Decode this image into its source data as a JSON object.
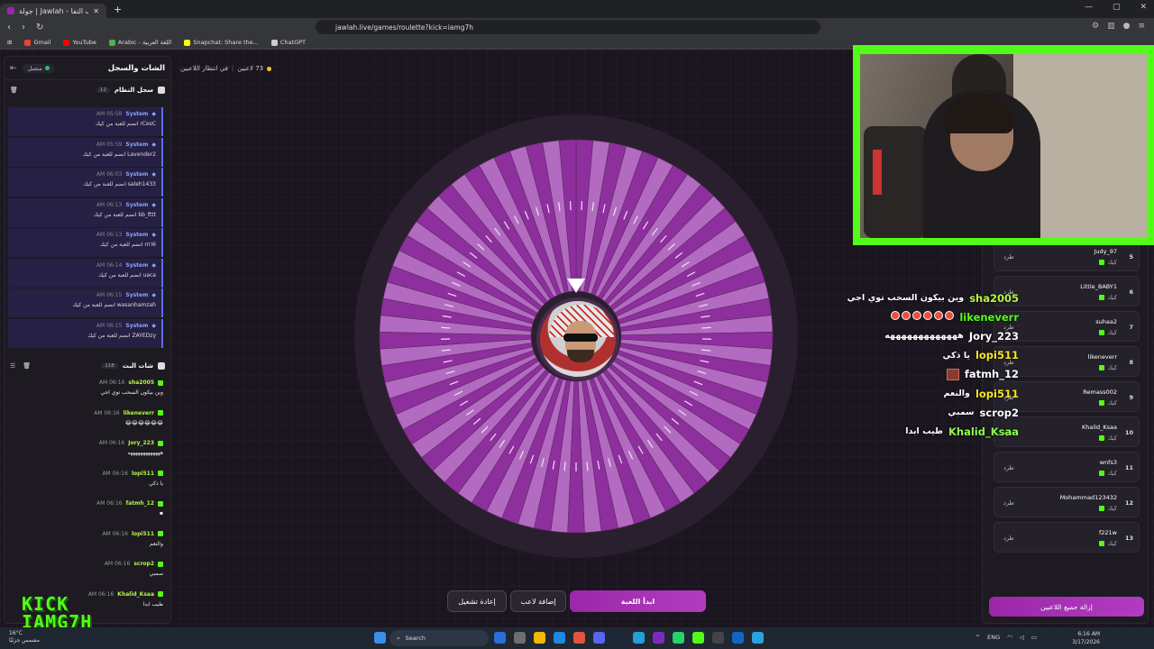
{
  "browser": {
    "tab_title": "جولة | Jawlah - منصة الألعاب التفا...",
    "url": "jawlah.live/games/roulette?kick=iamg7h",
    "bookmarks": [
      {
        "label": "Gmail",
        "color": "#ea4335"
      },
      {
        "label": "YouTube",
        "color": "#ff0000"
      },
      {
        "label": "Arabic - اللغة العربية",
        "color": "#4caf50"
      },
      {
        "label": "Snapchat: Share the...",
        "color": "#fffc00"
      },
      {
        "label": "ChatGPT",
        "color": "#cccccc"
      }
    ]
  },
  "chat_panel": {
    "title": "الشات والسجل",
    "connection_pill": "متصل",
    "system_log_title": "سجل النظام",
    "system_log_count": "12",
    "system_messages": [
      {
        "who": "System",
        "time": "AM 05:58",
        "body": "rCesC انضم للعبة من كيك"
      },
      {
        "who": "System",
        "time": "AM 05:59",
        "body": "Lavender2 انضم للعبة من كيك"
      },
      {
        "who": "System",
        "time": "AM 06:03",
        "body": "saleh1433 انضم للعبة من كيك"
      },
      {
        "who": "System",
        "time": "AM 06:13",
        "body": "bb_fttt انضم للعبة من كيك"
      },
      {
        "who": "System",
        "time": "AM 06:13",
        "body": "rrri6 انضم للعبة من كيك"
      },
      {
        "who": "System",
        "time": "AM 06:14",
        "body": "uaca انضم للعبة من كيك"
      },
      {
        "who": "System",
        "time": "AM 06:15",
        "body": "wasanhamzah انضم للعبة من كيك"
      },
      {
        "who": "System",
        "time": "AM 06:15",
        "body": "ZAYEDzy انضم للعبة من كيك"
      }
    ],
    "live_chat_title": "شات البث",
    "live_chat_count": "118",
    "live_messages": [
      {
        "who": "sha2005",
        "time": "AM 06:16",
        "body": "وين بيكون السحب توي اجي"
      },
      {
        "who": "likeneverr",
        "time": "AM 06:16",
        "body": "😂😂😂😂😂😂"
      },
      {
        "who": "Jory_223",
        "time": "AM 06:16",
        "body": "هههههههههههههه"
      },
      {
        "who": "lopi511",
        "time": "AM 06:16",
        "body": "يا ذكي"
      },
      {
        "who": "fatmh_12",
        "time": "AM 06:16",
        "body": "▪"
      },
      {
        "who": "lopi511",
        "time": "AM 06:16",
        "body": "والنعم"
      },
      {
        "who": "scrop2",
        "time": "AM 06:16",
        "body": "سمبي"
      },
      {
        "who": "Khalid_Ksaa",
        "time": "AM 06:16",
        "body": "طيب ابدا"
      }
    ]
  },
  "status": {
    "players_text": "73 لاعبين",
    "waiting_text": "في انتظار اللاعبين"
  },
  "wheel": {
    "segment_count": 73,
    "colors": [
      "#8e2f9e",
      "#b26bc0"
    ],
    "rim_color": "#2a1f2e"
  },
  "buttons": {
    "start": "ابدأ اللعبة",
    "add_player": "إضافة لاعب",
    "restart": "إعادة تشغيل",
    "clear_all": "إزالة جميع اللاعبين"
  },
  "overlay_chat": [
    {
      "user": "sha2005",
      "color": "#b6f542",
      "msg": "وين بيكون السحب توي اجي"
    },
    {
      "user": "likeneverr",
      "color": "#53fc18",
      "msg": "emoji-row"
    },
    {
      "user": "Jory_223",
      "color": "#ffffff",
      "msg": "هههههههههههههه"
    },
    {
      "user": "lopi511",
      "color": "#f5e625",
      "msg": "يا ذكي"
    },
    {
      "user": "fatmh_12",
      "color": "#ffffff",
      "msg": "emoji-square"
    },
    {
      "user": "lopi511",
      "color": "#f5e625",
      "msg": "والنعم"
    },
    {
      "user": "scrop2",
      "color": "#ffffff",
      "msg": "سمبي"
    },
    {
      "user": "Khalid_Ksaa",
      "color": "#8dff4a",
      "msg": "طيب ابدا"
    }
  ],
  "players": [
    {
      "num": "5",
      "name": "Judy_97",
      "sub": "كيك"
    },
    {
      "num": "6",
      "name": "Little_BABY1",
      "sub": "كيك"
    },
    {
      "num": "7",
      "name": "suhaa2",
      "sub": "كيك"
    },
    {
      "num": "8",
      "name": "likeneverr",
      "sub": "كيك"
    },
    {
      "num": "9",
      "name": "Remass002",
      "sub": "كيك"
    },
    {
      "num": "10",
      "name": "Khalid_Ksaa",
      "sub": "كيك"
    },
    {
      "num": "11",
      "name": "wnfs3",
      "sub": "كيك"
    },
    {
      "num": "12",
      "name": "Mohammad123432",
      "sub": "كيك"
    },
    {
      "num": "13",
      "name": "f221w",
      "sub": "كيك"
    }
  ],
  "kick_label": "طرد",
  "logo": {
    "line1": "KICK",
    "line2": "IAMG7H"
  },
  "taskbar": {
    "weather_temp": "16°C",
    "weather_desc": "مشمس جزئيًا",
    "search": "Search",
    "lang": "ENG",
    "time": "6:16 AM",
    "date": "3/17/2026"
  }
}
